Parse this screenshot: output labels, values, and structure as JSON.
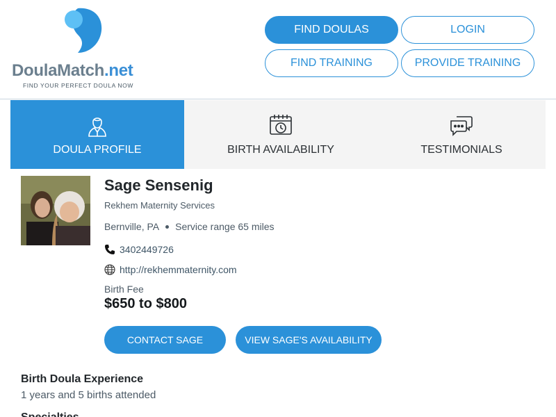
{
  "brand": {
    "name_main": "DoulaMatch",
    "name_suffix": ".net",
    "tagline": "FIND YOUR PERFECT DOULA NOW",
    "colors": {
      "primary": "#2b91d9",
      "light": "#5ec0f5",
      "gray": "#6b7f8e"
    }
  },
  "nav": {
    "find_doulas": "FIND DOULAS",
    "login": "LOGIN",
    "find_training": "FIND TRAINING",
    "provide_training": "PROVIDE TRAINING"
  },
  "tabs": [
    {
      "label": "DOULA PROFILE",
      "icon": "user-icon",
      "active": true
    },
    {
      "label": "BIRTH AVAILABILITY",
      "icon": "calendar-clock-icon",
      "active": false
    },
    {
      "label": "TESTIMONIALS",
      "icon": "chat-bubbles-icon",
      "active": false
    }
  ],
  "profile": {
    "name": "Sage Sensenig",
    "company": "Rekhem Maternity Services",
    "location": "Bernville, PA",
    "service_range": "Service range 65 miles",
    "phone": "3402449726",
    "website": "http://rekhemmaternity.com",
    "fee_label": "Birth Fee",
    "fee": "$650 to $800",
    "contact_button": "CONTACT SAGE",
    "availability_button": "VIEW SAGE'S AVAILABILITY"
  },
  "experience": {
    "title": "Birth Doula Experience",
    "text": "1 years and 5 births attended"
  },
  "next_section": {
    "title": "Specialties"
  }
}
